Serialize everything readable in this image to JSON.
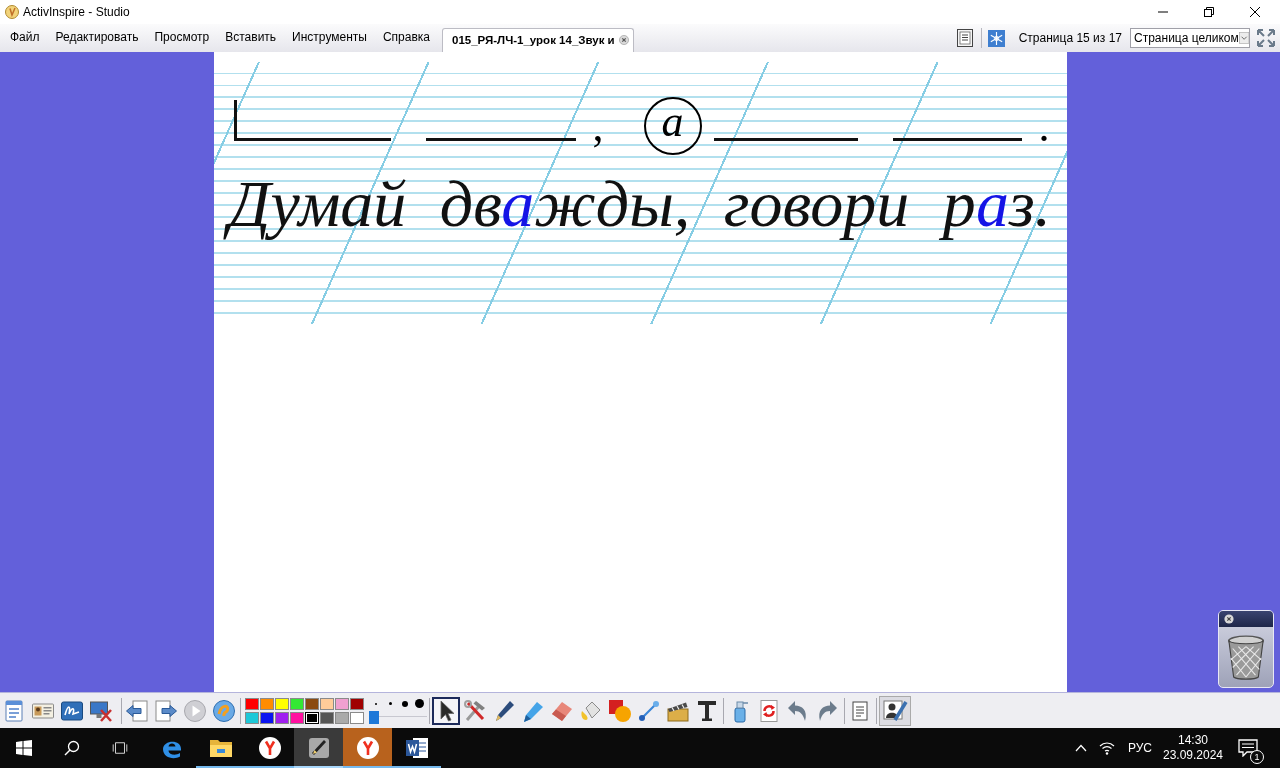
{
  "window": {
    "title": "ActivInspire - Studio"
  },
  "menu": [
    "Файл",
    "Редактировать",
    "Просмотр",
    "Вставить",
    "Инструменты",
    "Справка"
  ],
  "document_tab": {
    "label": "015_РЯ-ЛЧ-1_урок 14_Звук и"
  },
  "page_navigation": {
    "label": "Страница 15 из 17",
    "zoom": "Страница целиком"
  },
  "page": {
    "scheme": [
      {
        "kind": "word",
        "capital": true
      },
      {
        "kind": "word",
        "capital": false
      },
      {
        "kind": "punct",
        "text": ","
      },
      {
        "kind": "circled",
        "text": "а"
      },
      {
        "kind": "word",
        "capital": false
      },
      {
        "kind": "word",
        "capital": false
      },
      {
        "kind": "punct",
        "text": "."
      }
    ],
    "sentence": [
      {
        "text": "Думай дв",
        "highlighted": false
      },
      {
        "text": "а",
        "highlighted": true
      },
      {
        "text": "жды, говори р",
        "highlighted": false
      },
      {
        "text": "а",
        "highlighted": true
      },
      {
        "text": "з.",
        "highlighted": false
      }
    ]
  },
  "toolbar": {
    "colors": [
      {
        "color": "#ff0000",
        "selected": false
      },
      {
        "color": "#ff8c00",
        "selected": false
      },
      {
        "color": "#ffff00",
        "selected": false
      },
      {
        "color": "#33e833",
        "selected": false
      },
      {
        "color": "#8b4a10",
        "selected": false
      },
      {
        "color": "#ffcc99",
        "selected": false
      },
      {
        "color": "#f0a0d0",
        "selected": false
      },
      {
        "color": "#a00000",
        "selected": false
      },
      {
        "color": "#1ec8d8",
        "selected": false
      },
      {
        "color": "#0a14f0",
        "selected": false
      },
      {
        "color": "#a020f0",
        "selected": false
      },
      {
        "color": "#ff10a0",
        "selected": false
      },
      {
        "color": "#000000",
        "selected": true
      },
      {
        "color": "#555555",
        "selected": false
      },
      {
        "color": "#aaaaaa",
        "selected": false
      },
      {
        "color": "#ffffff",
        "selected": false
      }
    ],
    "pen_width": {
      "level": 0
    },
    "tools": [
      {
        "kind": "select",
        "selected": true
      },
      {
        "kind": "tools",
        "selected": false
      },
      {
        "kind": "pen",
        "selected": false
      },
      {
        "kind": "highlighter",
        "selected": false
      },
      {
        "kind": "eraser",
        "selected": false
      },
      {
        "kind": "fill",
        "selected": false
      },
      {
        "kind": "shapes",
        "selected": false
      },
      {
        "kind": "connector",
        "selected": false
      },
      {
        "kind": "clipart",
        "selected": false
      },
      {
        "kind": "text",
        "selected": false
      }
    ]
  },
  "taskbar": {
    "apps": [
      {
        "kind": "edge",
        "running": false,
        "selected": false,
        "flashing": false
      },
      {
        "kind": "explorer",
        "running": true,
        "selected": false,
        "flashing": false
      },
      {
        "kind": "yandex",
        "running": true,
        "selected": false,
        "flashing": false
      },
      {
        "kind": "activinspire",
        "running": true,
        "selected": true,
        "flashing": false
      },
      {
        "kind": "yandex",
        "running": true,
        "selected": false,
        "flashing": true
      },
      {
        "kind": "word",
        "running": true,
        "selected": false,
        "flashing": false
      }
    ],
    "language": "РУС",
    "time": "14:30",
    "date": "23.09.2024",
    "notifications": "1"
  }
}
